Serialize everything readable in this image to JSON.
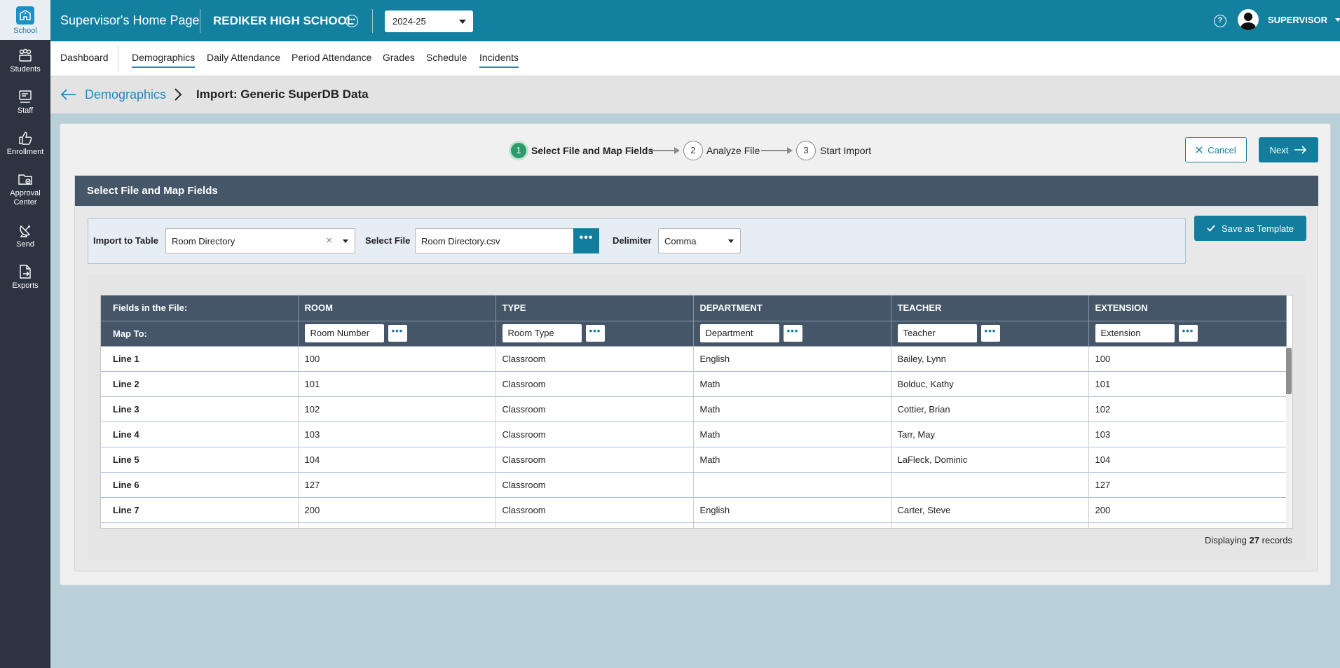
{
  "rail": {
    "items": [
      {
        "label": "School",
        "icon": "school-icon",
        "active": true
      },
      {
        "label": "Students",
        "icon": "students-icon"
      },
      {
        "label": "Staff",
        "icon": "staff-icon"
      },
      {
        "label": "Enrollment",
        "icon": "thumbs-up-icon"
      },
      {
        "label": "Approval Center",
        "icon": "folder-check-icon"
      },
      {
        "label": "Send",
        "icon": "satellite-dish-icon"
      },
      {
        "label": "Exports",
        "icon": "export-file-icon"
      }
    ]
  },
  "header": {
    "home_title": "Supervisor's Home Page",
    "school_name": "REDIKER HIGH SCHOOL",
    "school_year": "2024-25",
    "user_name": "SUPERVISOR",
    "brand_color": "#13809f"
  },
  "nav": {
    "tabs": [
      {
        "label": "Dashboard"
      },
      {
        "label": "Demographics",
        "active": true
      },
      {
        "label": "Daily Attendance"
      },
      {
        "label": "Period Attendance"
      },
      {
        "label": "Grades"
      },
      {
        "label": "Schedule"
      },
      {
        "label": "Incidents",
        "active": true
      }
    ]
  },
  "breadcrumb": {
    "parent": "Demographics",
    "current": "Import: Generic SuperDB Data"
  },
  "wizard": {
    "steps": [
      {
        "number": "1",
        "label": "Select File and Map Fields",
        "current": true
      },
      {
        "number": "2",
        "label": "Analyze File"
      },
      {
        "number": "3",
        "label": "Start Import"
      }
    ],
    "cancel_label": "Cancel",
    "next_label": "Next"
  },
  "panel": {
    "title": "Select File and Map Fields",
    "import_to_label": "Import to Table",
    "import_to_value": "Room Directory",
    "select_file_label": "Select File",
    "select_file_value": "Room Directory.csv",
    "delimiter_label": "Delimiter",
    "delimiter_value": "Comma",
    "save_template_label": "Save as Template"
  },
  "grid": {
    "fields_label": "Fields in the File:",
    "map_label": "Map To:",
    "columns": [
      "ROOM",
      "TYPE",
      "DEPARTMENT",
      "TEACHER",
      "EXTENSION"
    ],
    "map_to": [
      "Room Number",
      "Room Type",
      "Department",
      "Teacher",
      "Extension"
    ],
    "rows": [
      {
        "line": "Line 1",
        "cells": [
          "100",
          "Classroom",
          "English",
          "Bailey, Lynn",
          "100"
        ]
      },
      {
        "line": "Line 2",
        "cells": [
          "101",
          "Classroom",
          "Math",
          "Bolduc, Kathy",
          "101"
        ]
      },
      {
        "line": "Line 3",
        "cells": [
          "102",
          "Classroom",
          "Math",
          "Cottier, Brian",
          "102"
        ]
      },
      {
        "line": "Line 4",
        "cells": [
          "103",
          "Classroom",
          "Math",
          "Tarr, May",
          "103"
        ]
      },
      {
        "line": "Line 5",
        "cells": [
          "104",
          "Classroom",
          "Math",
          "LaFleck, Dominic",
          "104"
        ]
      },
      {
        "line": "Line 6",
        "cells": [
          "127",
          "Classroom",
          "",
          "",
          "127"
        ]
      },
      {
        "line": "Line 7",
        "cells": [
          "200",
          "Classroom",
          "English",
          "Carter, Steve",
          "200"
        ]
      },
      {
        "line": "",
        "cells": [
          "",
          "",
          "",
          "",
          ""
        ]
      }
    ],
    "records_prefix": "Displaying",
    "records_count": "27",
    "records_suffix": "records"
  }
}
